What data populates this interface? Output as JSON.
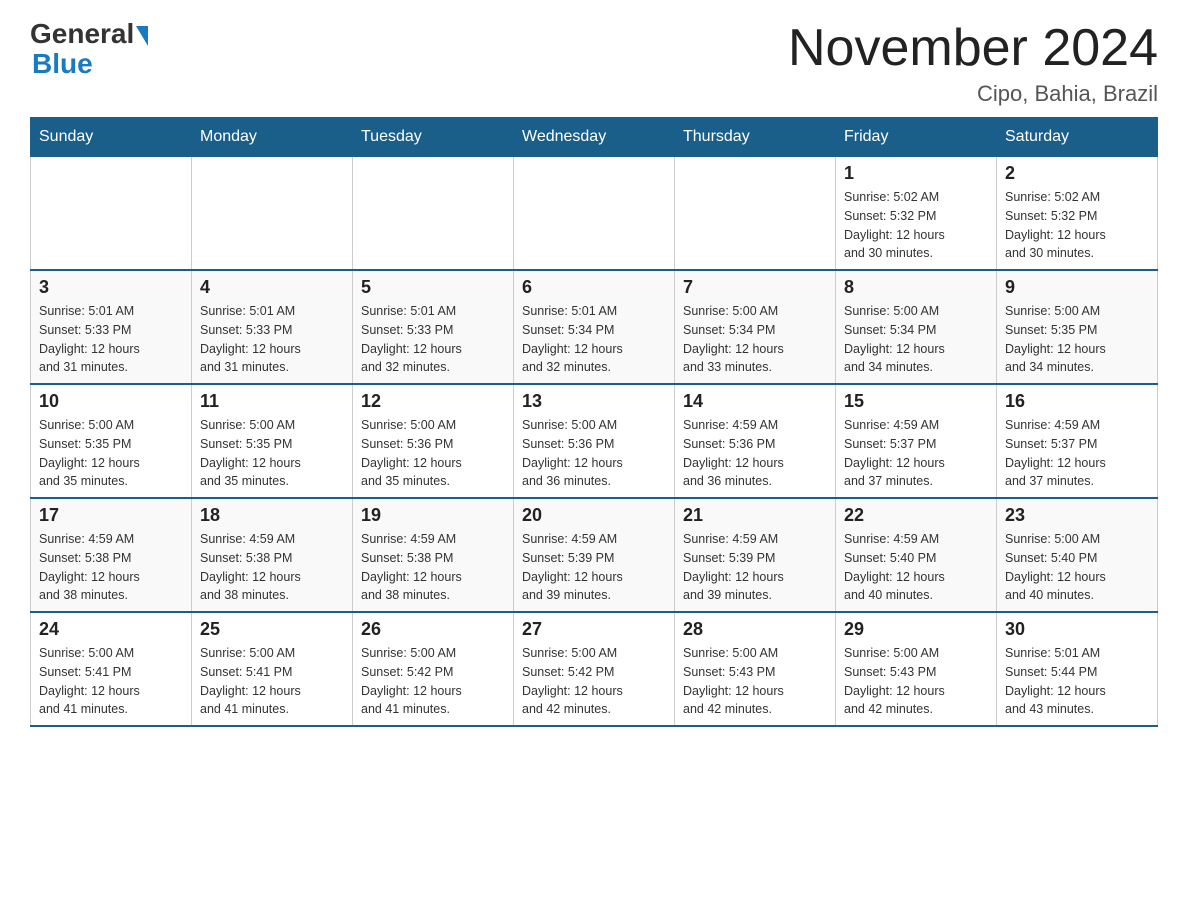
{
  "header": {
    "logo_general": "General",
    "logo_blue": "Blue",
    "month_title": "November 2024",
    "location": "Cipo, Bahia, Brazil"
  },
  "days_of_week": [
    "Sunday",
    "Monday",
    "Tuesday",
    "Wednesday",
    "Thursday",
    "Friday",
    "Saturday"
  ],
  "weeks": [
    [
      {
        "day": "",
        "info": ""
      },
      {
        "day": "",
        "info": ""
      },
      {
        "day": "",
        "info": ""
      },
      {
        "day": "",
        "info": ""
      },
      {
        "day": "",
        "info": ""
      },
      {
        "day": "1",
        "info": "Sunrise: 5:02 AM\nSunset: 5:32 PM\nDaylight: 12 hours\nand 30 minutes."
      },
      {
        "day": "2",
        "info": "Sunrise: 5:02 AM\nSunset: 5:32 PM\nDaylight: 12 hours\nand 30 minutes."
      }
    ],
    [
      {
        "day": "3",
        "info": "Sunrise: 5:01 AM\nSunset: 5:33 PM\nDaylight: 12 hours\nand 31 minutes."
      },
      {
        "day": "4",
        "info": "Sunrise: 5:01 AM\nSunset: 5:33 PM\nDaylight: 12 hours\nand 31 minutes."
      },
      {
        "day": "5",
        "info": "Sunrise: 5:01 AM\nSunset: 5:33 PM\nDaylight: 12 hours\nand 32 minutes."
      },
      {
        "day": "6",
        "info": "Sunrise: 5:01 AM\nSunset: 5:34 PM\nDaylight: 12 hours\nand 32 minutes."
      },
      {
        "day": "7",
        "info": "Sunrise: 5:00 AM\nSunset: 5:34 PM\nDaylight: 12 hours\nand 33 minutes."
      },
      {
        "day": "8",
        "info": "Sunrise: 5:00 AM\nSunset: 5:34 PM\nDaylight: 12 hours\nand 34 minutes."
      },
      {
        "day": "9",
        "info": "Sunrise: 5:00 AM\nSunset: 5:35 PM\nDaylight: 12 hours\nand 34 minutes."
      }
    ],
    [
      {
        "day": "10",
        "info": "Sunrise: 5:00 AM\nSunset: 5:35 PM\nDaylight: 12 hours\nand 35 minutes."
      },
      {
        "day": "11",
        "info": "Sunrise: 5:00 AM\nSunset: 5:35 PM\nDaylight: 12 hours\nand 35 minutes."
      },
      {
        "day": "12",
        "info": "Sunrise: 5:00 AM\nSunset: 5:36 PM\nDaylight: 12 hours\nand 35 minutes."
      },
      {
        "day": "13",
        "info": "Sunrise: 5:00 AM\nSunset: 5:36 PM\nDaylight: 12 hours\nand 36 minutes."
      },
      {
        "day": "14",
        "info": "Sunrise: 4:59 AM\nSunset: 5:36 PM\nDaylight: 12 hours\nand 36 minutes."
      },
      {
        "day": "15",
        "info": "Sunrise: 4:59 AM\nSunset: 5:37 PM\nDaylight: 12 hours\nand 37 minutes."
      },
      {
        "day": "16",
        "info": "Sunrise: 4:59 AM\nSunset: 5:37 PM\nDaylight: 12 hours\nand 37 minutes."
      }
    ],
    [
      {
        "day": "17",
        "info": "Sunrise: 4:59 AM\nSunset: 5:38 PM\nDaylight: 12 hours\nand 38 minutes."
      },
      {
        "day": "18",
        "info": "Sunrise: 4:59 AM\nSunset: 5:38 PM\nDaylight: 12 hours\nand 38 minutes."
      },
      {
        "day": "19",
        "info": "Sunrise: 4:59 AM\nSunset: 5:38 PM\nDaylight: 12 hours\nand 38 minutes."
      },
      {
        "day": "20",
        "info": "Sunrise: 4:59 AM\nSunset: 5:39 PM\nDaylight: 12 hours\nand 39 minutes."
      },
      {
        "day": "21",
        "info": "Sunrise: 4:59 AM\nSunset: 5:39 PM\nDaylight: 12 hours\nand 39 minutes."
      },
      {
        "day": "22",
        "info": "Sunrise: 4:59 AM\nSunset: 5:40 PM\nDaylight: 12 hours\nand 40 minutes."
      },
      {
        "day": "23",
        "info": "Sunrise: 5:00 AM\nSunset: 5:40 PM\nDaylight: 12 hours\nand 40 minutes."
      }
    ],
    [
      {
        "day": "24",
        "info": "Sunrise: 5:00 AM\nSunset: 5:41 PM\nDaylight: 12 hours\nand 41 minutes."
      },
      {
        "day": "25",
        "info": "Sunrise: 5:00 AM\nSunset: 5:41 PM\nDaylight: 12 hours\nand 41 minutes."
      },
      {
        "day": "26",
        "info": "Sunrise: 5:00 AM\nSunset: 5:42 PM\nDaylight: 12 hours\nand 41 minutes."
      },
      {
        "day": "27",
        "info": "Sunrise: 5:00 AM\nSunset: 5:42 PM\nDaylight: 12 hours\nand 42 minutes."
      },
      {
        "day": "28",
        "info": "Sunrise: 5:00 AM\nSunset: 5:43 PM\nDaylight: 12 hours\nand 42 minutes."
      },
      {
        "day": "29",
        "info": "Sunrise: 5:00 AM\nSunset: 5:43 PM\nDaylight: 12 hours\nand 42 minutes."
      },
      {
        "day": "30",
        "info": "Sunrise: 5:01 AM\nSunset: 5:44 PM\nDaylight: 12 hours\nand 43 minutes."
      }
    ]
  ]
}
